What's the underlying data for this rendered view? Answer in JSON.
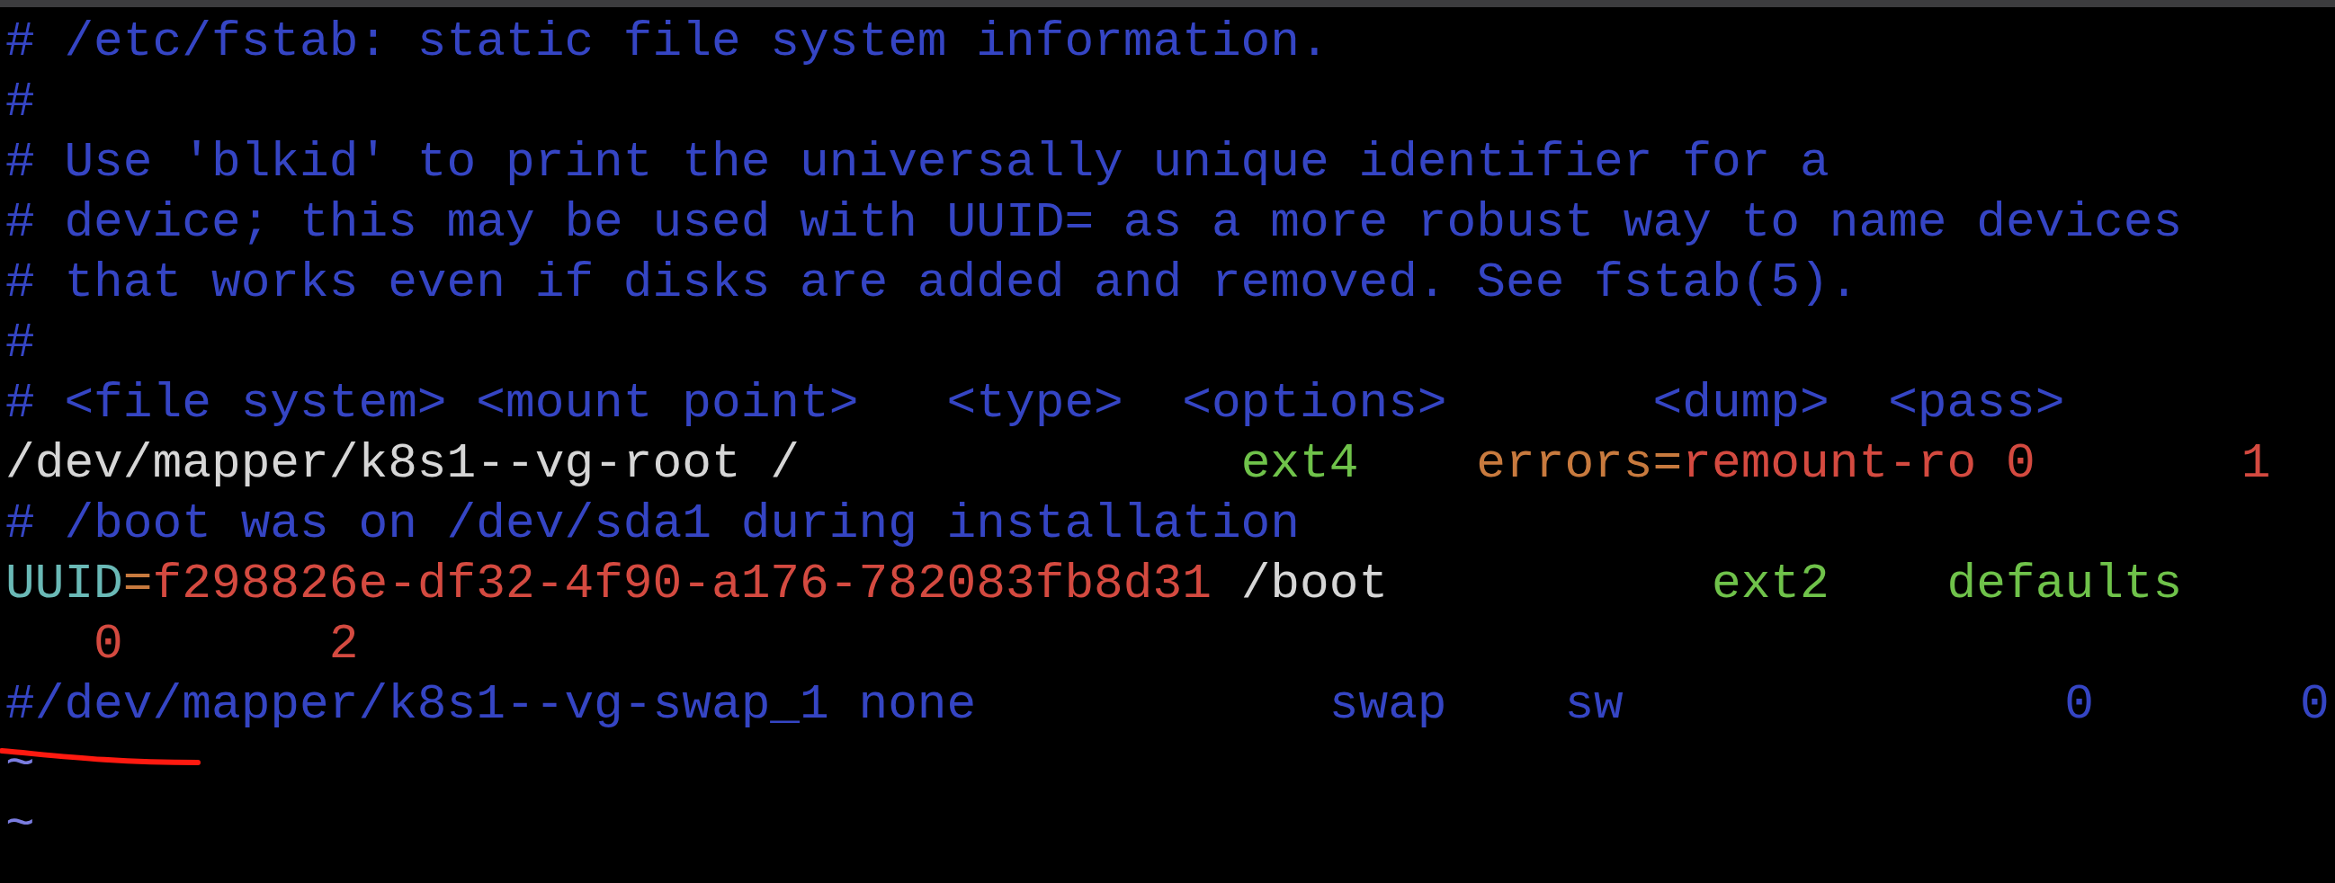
{
  "editor": {
    "lines": [
      {
        "segments": [
          {
            "kind": "comment",
            "text": "# /etc/fstab: static file system information."
          }
        ]
      },
      {
        "segments": [
          {
            "kind": "comment",
            "text": "#"
          }
        ]
      },
      {
        "segments": [
          {
            "kind": "comment",
            "text": "# Use 'blkid' to print the universally unique identifier for a"
          }
        ]
      },
      {
        "segments": [
          {
            "kind": "comment",
            "text": "# device; this may be used with UUID= as a more robust way to name devices"
          }
        ]
      },
      {
        "segments": [
          {
            "kind": "comment",
            "text": "# that works even if disks are added and removed. See fstab(5)."
          }
        ]
      },
      {
        "segments": [
          {
            "kind": "comment",
            "text": "#"
          }
        ]
      },
      {
        "segments": [
          {
            "kind": "comment",
            "text": "# <file system> <mount point>   <type>  <options>       <dump>  <pass>"
          }
        ]
      },
      {
        "segments": [
          {
            "kind": "plain",
            "text": "/dev/mapper/k8s1--vg-root /"
          },
          {
            "kind": "type",
            "text": "               ext4"
          },
          {
            "kind": "option",
            "text": "    errors="
          },
          {
            "kind": "value",
            "text": "remount-ro"
          },
          {
            "kind": "value",
            "text": " 0"
          },
          {
            "kind": "value",
            "text": "       1"
          }
        ]
      },
      {
        "segments": [
          {
            "kind": "comment",
            "text": "# /boot was on /dev/sda1 during installation"
          }
        ]
      },
      {
        "segments": [
          {
            "kind": "key",
            "text": "UUID"
          },
          {
            "kind": "option",
            "text": "="
          },
          {
            "kind": "value",
            "text": "f298826e-df32-4f90-a176-782083fb8d31"
          },
          {
            "kind": "plain",
            "text": " /boot"
          },
          {
            "kind": "type",
            "text": "           ext2"
          },
          {
            "kind": "type",
            "text": "    defaults"
          }
        ]
      },
      {
        "segments": [
          {
            "kind": "value",
            "text": "   0"
          },
          {
            "kind": "value",
            "text": "       2"
          }
        ]
      },
      {
        "segments": [
          {
            "kind": "comment",
            "text": "#/dev/mapper/k8s1--vg-swap_1 none            swap    sw               0       0"
          }
        ]
      },
      {
        "segments": [
          {
            "kind": "tilde",
            "text": "~"
          }
        ]
      },
      {
        "segments": [
          {
            "kind": "tilde",
            "text": "~"
          }
        ]
      }
    ]
  },
  "annotations": [
    {
      "kind": "underline"
    }
  ]
}
